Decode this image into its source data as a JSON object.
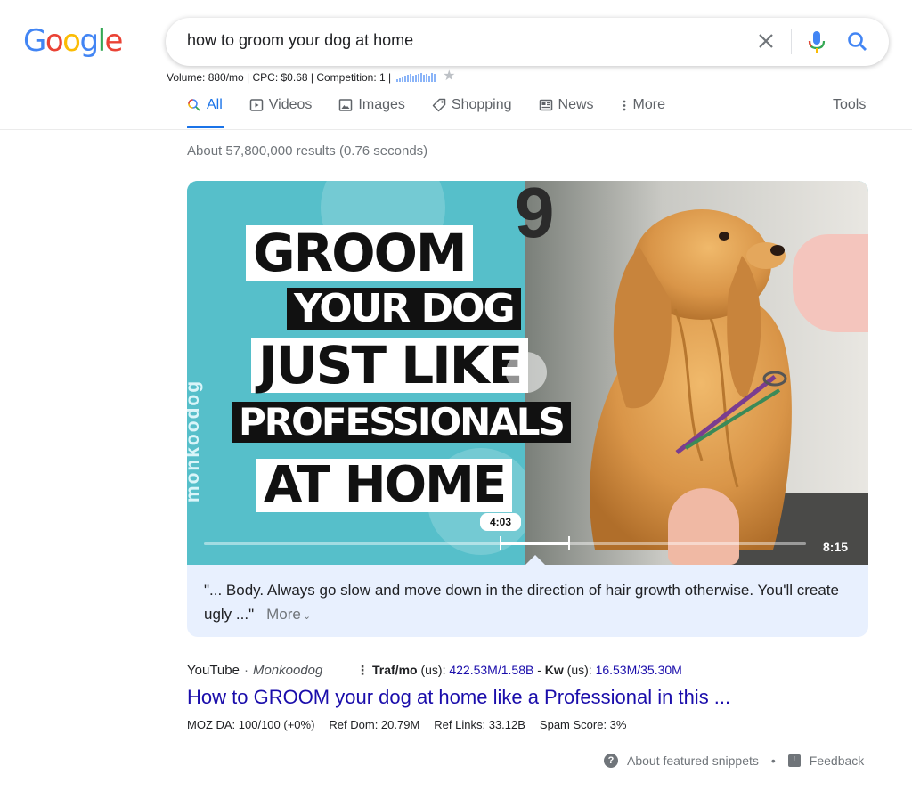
{
  "logo": {
    "letters": [
      "G",
      "o",
      "o",
      "g",
      "l",
      "e"
    ],
    "colors": [
      "#4285f4",
      "#ea4335",
      "#fbbc05",
      "#4285f4",
      "#34a853",
      "#ea4335"
    ]
  },
  "search": {
    "query": "how to groom your dog at home"
  },
  "seo_bar": {
    "text": "Volume: 880/mo | CPC: $0.68 | Competition: 1 |",
    "trend": [
      3,
      4,
      5,
      6,
      7,
      8,
      6,
      7,
      8,
      9,
      7,
      8,
      6,
      9,
      8
    ]
  },
  "tabs": [
    {
      "label": "All",
      "icon": "search-icon",
      "active": true
    },
    {
      "label": "Videos",
      "icon": "play-square-icon",
      "active": false
    },
    {
      "label": "Images",
      "icon": "image-icon",
      "active": false
    },
    {
      "label": "Shopping",
      "icon": "tag-icon",
      "active": false
    },
    {
      "label": "News",
      "icon": "newspaper-icon",
      "active": false
    },
    {
      "label": "More",
      "icon": "kebab-icon",
      "active": false
    }
  ],
  "tools_label": "Tools",
  "result_stats": "About 57,800,000 results (0.76 seconds)",
  "video": {
    "brand": "monkoodog",
    "title_lines": [
      "GROOM",
      "YOUR DOG",
      "JUST LIKE",
      "PROFESSIONALS",
      "AT HOME"
    ],
    "timestamp": "4:03",
    "duration": "8:15",
    "progress_start": 0.493,
    "progress_end": 0.584,
    "snippet": "\"... Body. Always go slow and move down in the direction of hair growth otherwise. You'll create ugly ...\"",
    "more_label": "More"
  },
  "result": {
    "site": "YouTube",
    "author": "Monkoodog",
    "traf_label": "Traf/mo",
    "traf_region": "(us):",
    "traf_value": "422.53M/1.58B",
    "kw_label": "Kw",
    "kw_region": "(us):",
    "kw_value": "16.53M/35.30M",
    "title": "How to GROOM your dog at home like a Professional in this ...",
    "moz": [
      "MOZ DA: 100/100 (+0%)",
      "Ref Dom: 20.79M",
      "Ref Links: 33.12B",
      "Spam Score: 3%"
    ]
  },
  "footer": {
    "about": "About featured snippets",
    "feedback": "Feedback"
  }
}
